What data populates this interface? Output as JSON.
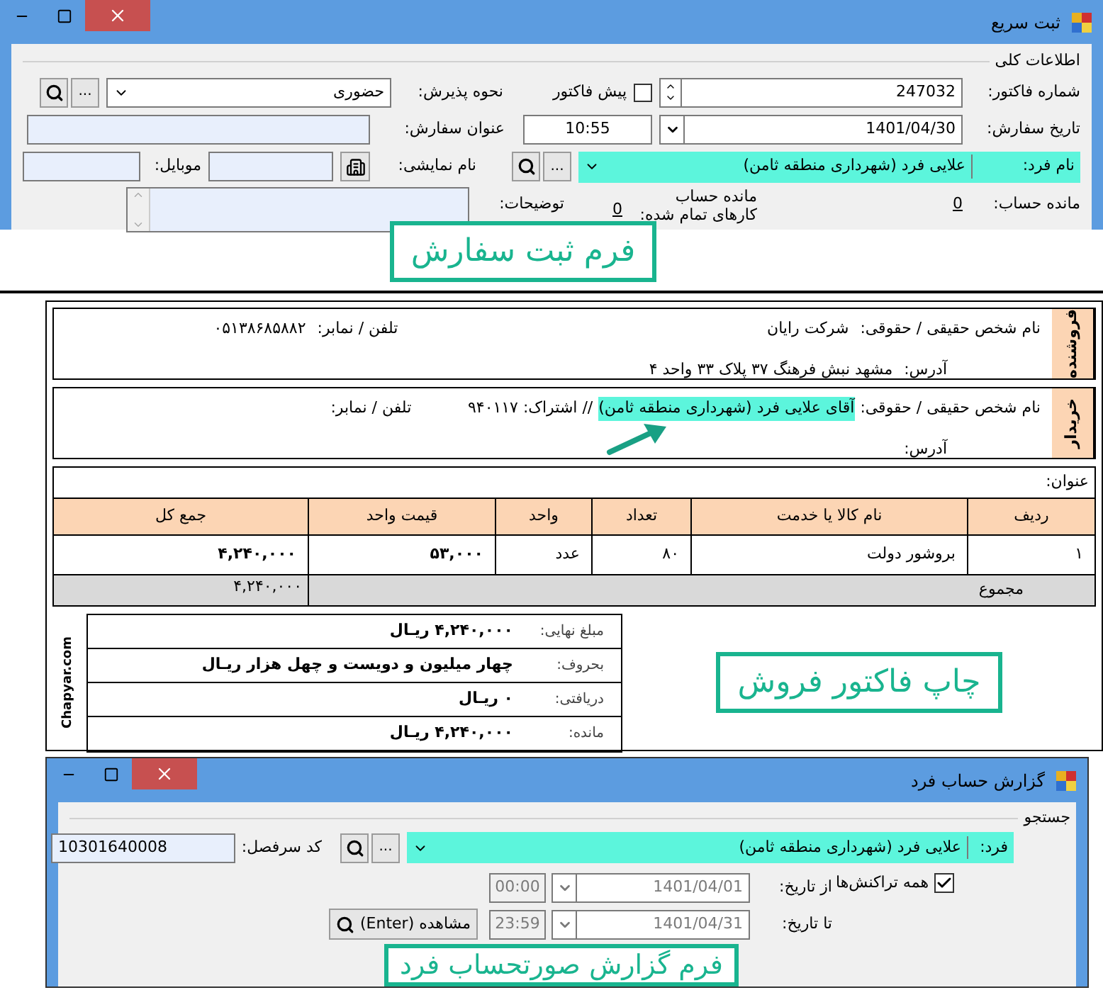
{
  "order_window": {
    "title": "ثبت سریع",
    "group": "اطلاعات کلی",
    "invoice_number": {
      "label": "شماره فاکتور:",
      "value": "247032"
    },
    "pre_invoice": {
      "label": "پیش فاکتور",
      "checked": false
    },
    "reception": {
      "label": "نحوه پذیرش:",
      "value": "حضوری",
      "browse_button": "..."
    },
    "order_date": {
      "label": "تاریخ سفارش:",
      "date": "1401/04/30",
      "time": "10:55"
    },
    "order_title": {
      "label": "عنوان سفارش:"
    },
    "person": {
      "label": "نام فرد:",
      "value": "علایی فرد  (شهرداری منطقه ثامن)",
      "browse_button": "..."
    },
    "display_name": {
      "label": "نام نمایشی:"
    },
    "mobile": {
      "label": "موبایل:"
    },
    "balance": {
      "label": "مانده حساب:",
      "value": "0"
    },
    "completed": {
      "label_1": "مانده حساب",
      "label_2": "کارهای تمام شده:",
      "value": "0"
    },
    "notes": {
      "label": "توضیحات:"
    },
    "caption": "فرم ثبت سفارش"
  },
  "invoice": {
    "seller": {
      "tab": "فروشنده",
      "name_label": "نام شخص حقیقی / حقوقی:",
      "name": "شرکت رایان",
      "phone_label": "تلفن / نمابر:",
      "phone": "۰۵۱۳۸۶۸۵۸۸۲",
      "address_label": "آدرس:",
      "address": "مشهد نبش فرهنگ ۳۷ پلاک ۳۳ واحد ۴"
    },
    "buyer": {
      "tab": "خریدار",
      "name_label": "نام شخص حقیقی / حقوقی:",
      "name": "آقای علایی فرد (شهرداری منطقه ثامن)",
      "subscription": "// اشتراک: ۹۴۰۱۱۷",
      "phone_label": "تلفن / نمابر:",
      "address_label": "آدرس:"
    },
    "title_label": "عنوان:",
    "columns": [
      "ردیف",
      "نام کالا یا خدمت",
      "تعداد",
      "واحد",
      "قیمت واحد",
      "جمع کل"
    ],
    "rows": [
      [
        "۱",
        "بروشور دولت",
        "۸۰",
        "عدد",
        "۵۳,۰۰۰",
        "۴,۲۴۰,۰۰۰"
      ]
    ],
    "total_label": "مجموع",
    "total": "۴,۲۴۰,۰۰۰",
    "summary": [
      {
        "label": "مبلغ نهایی:",
        "value": "۴,۲۴۰,۰۰۰ ریـال"
      },
      {
        "label": "بحروف:",
        "value": "چهار میلیون و دویست و چهل هزار ریـال"
      },
      {
        "label": "دریافتی:",
        "value": "۰ ریـال"
      },
      {
        "label": "مانده:",
        "value": "۴,۲۴۰,۰۰۰ ریـال"
      }
    ],
    "credit": "Chapyar.com",
    "caption": "چاپ فاکتور فروش"
  },
  "report_window": {
    "title": "گزارش حساب فرد",
    "group": "جستجو",
    "person": {
      "label": "فرد:",
      "value": "علایی فرد  (شهرداری منطقه ثامن)",
      "browse_button": "..."
    },
    "account_code": {
      "label": "کد سرفصل:",
      "value": "10301640008"
    },
    "all_transactions": {
      "label": "همه  تراکنش‌ها",
      "checked": true
    },
    "from": {
      "label": "از تاریخ:",
      "date": "1401/04/01",
      "time": "00:00",
      "disabled": true
    },
    "to": {
      "label": "تا تاریخ:",
      "date": "1401/04/31",
      "time": "23:59",
      "disabled": true
    },
    "view_button": "مشاهده (Enter)",
    "caption": "فرم گزارش صورتحساب فرد"
  }
}
